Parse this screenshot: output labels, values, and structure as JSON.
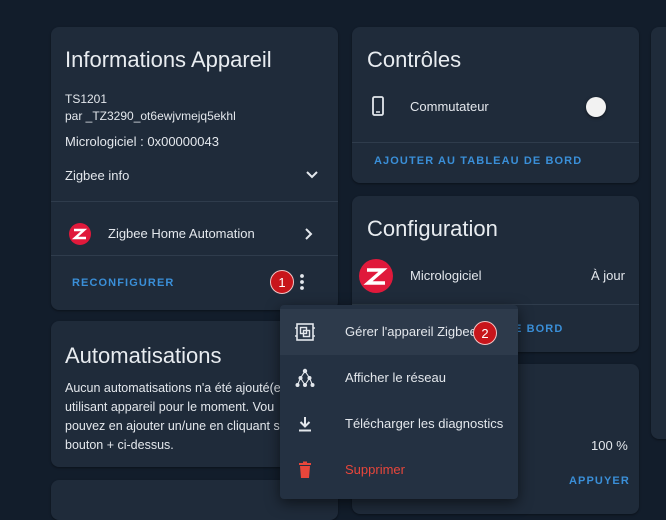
{
  "device_info": {
    "title": "Informations Appareil",
    "model": "TS1201",
    "manufacturer": "par _TZ3290_ot6ewjvmejq5ekhl",
    "firmware": "Micrologiciel : 0x00000043",
    "zigbee_info": "Zigbee info",
    "integration": "Zigbee Home Automation",
    "reconfigure": "RECONFIGURER"
  },
  "controls": {
    "title": "Contrôles",
    "switch_label": "Commutateur",
    "switch_on": false,
    "add_dashboard": "AJOUTER AU TABLEAU DE BORD"
  },
  "configuration": {
    "title": "Configuration",
    "firmware_label": "Micrologiciel",
    "firmware_status": "À jour",
    "add_dashboard_partial": "E BORD"
  },
  "automations": {
    "title": "Automatisations",
    "lines": [
      "Aucun automatisations n'a été ajouté(e",
      "utilisant appareil pour le moment. Vou",
      "pouvez en ajouter un/une en cliquant s",
      "bouton + ci-dessus."
    ]
  },
  "diagnostics_card": {
    "value": "100 %",
    "action": "APPUYER"
  },
  "menu": {
    "items": [
      {
        "label": "Gérer l'appareil Zigbee",
        "icon": "device-manage-icon"
      },
      {
        "label": "Afficher le réseau",
        "icon": "network-icon"
      },
      {
        "label": "Télécharger les diagnostics",
        "icon": "download-icon"
      },
      {
        "label": "Supprimer",
        "icon": "trash-icon",
        "danger": true
      }
    ]
  },
  "badges": {
    "one": "1",
    "two": "2"
  },
  "colors": {
    "background": "#121d2b",
    "card": "#1f2b3a",
    "accent": "#3a8fd8",
    "zigbee": "#e0193b",
    "danger": "#e8463b",
    "badge": "#c8151b"
  }
}
